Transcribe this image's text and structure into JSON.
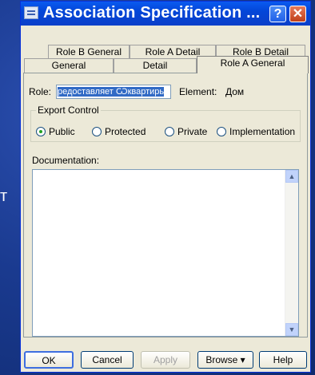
{
  "background": {
    "left_letter": "т"
  },
  "window": {
    "title": "Association Specification ...",
    "help_glyph": "?",
    "close_glyph": "✕"
  },
  "tabs": {
    "row1": [
      "Role B General",
      "Role A Detail",
      "Role B Detail"
    ],
    "row2": [
      "General",
      "Detail",
      "Role A General"
    ],
    "active": "Role A General"
  },
  "form": {
    "role_label": "Role:",
    "role_value": "редоставляет Ѿквартирь",
    "element_label": "Element:",
    "element_value": "Дом",
    "export_control_title": "Export Control",
    "export_options": [
      "Public",
      "Protected",
      "Private",
      "Implementation"
    ],
    "export_selected": "Public",
    "documentation_label": "Documentation:",
    "documentation_text": ""
  },
  "buttons": {
    "ok": "OK",
    "cancel": "Cancel",
    "apply": "Apply",
    "browse": "Browse ▾",
    "help": "Help"
  },
  "colors": {
    "titlebar": "#0346d8",
    "dialog_bg": "#ece9d8",
    "selection": "#316ac5",
    "radio_dot": "#21a121"
  }
}
